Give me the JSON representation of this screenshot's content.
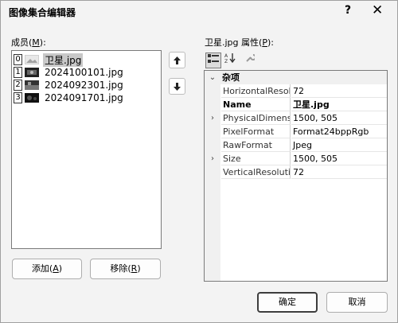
{
  "window": {
    "title": "图像集合编辑器",
    "help_icon": "?",
    "close_icon": "✕"
  },
  "members": {
    "label": "成员(",
    "label_key": "M",
    "label_end": "):",
    "items": [
      {
        "index": "0",
        "name": "卫星.jpg",
        "selected": true
      },
      {
        "index": "1",
        "name": "2024100101.jpg",
        "selected": false
      },
      {
        "index": "2",
        "name": "2024092301.jpg",
        "selected": false
      },
      {
        "index": "3",
        "name": "2024091701.jpg",
        "selected": false
      }
    ],
    "move_up_icon": "arrow-up-icon",
    "move_down_icon": "arrow-down-icon"
  },
  "buttons": {
    "add": "添加(",
    "add_key": "A",
    "add_end": ")",
    "remove": "移除(",
    "remove_key": "R",
    "remove_end": ")",
    "ok": "确定",
    "cancel": "取消"
  },
  "properties": {
    "label": "卫星.jpg 属性(",
    "label_key": "P",
    "label_end": "):",
    "category": "杂项",
    "rows": [
      {
        "name": "HorizontalResolution",
        "value": "72",
        "expandable": false,
        "bold": false
      },
      {
        "name": "Name",
        "value": "卫星.jpg",
        "expandable": false,
        "bold": true
      },
      {
        "name": "PhysicalDimension",
        "value": "1500, 505",
        "expandable": true,
        "bold": false
      },
      {
        "name": "PixelFormat",
        "value": "Format24bppRgb",
        "expandable": false,
        "bold": false
      },
      {
        "name": "RawFormat",
        "value": "Jpeg",
        "expandable": false,
        "bold": false
      },
      {
        "name": "Size",
        "value": "1500, 505",
        "expandable": true,
        "bold": false
      },
      {
        "name": "VerticalResolution",
        "value": "72",
        "expandable": false,
        "bold": false
      }
    ]
  }
}
